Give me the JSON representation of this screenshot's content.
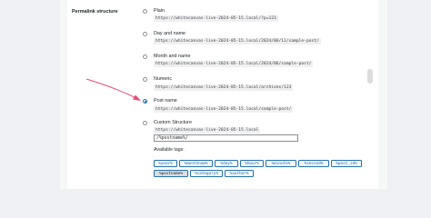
{
  "section": {
    "label": "Permalink structure"
  },
  "options": [
    {
      "label": "Plain",
      "example": "https://whitecanvas-live-2024-05-15.local/?p=123",
      "checked": false
    },
    {
      "label": "Day and name",
      "example": "https://whitecanvas-live-2024-05-15.local/2024/06/11/sample-post/",
      "checked": false
    },
    {
      "label": "Month and name",
      "example": "https://whitecanvas-live-2024-05-15.local/2024/06/sample-post/",
      "checked": false
    },
    {
      "label": "Numeric",
      "example": "https://whitecanvas-live-2024-05-15.local/archives/123",
      "checked": false
    },
    {
      "label": "Post name",
      "example": "https://whitecanvas-live-2024-05-15.local/sample-post/",
      "checked": true
    },
    {
      "label": "Custom Structure",
      "checked": false
    }
  ],
  "custom": {
    "prefix": "https://whitecanvas-live-2024-05-15.local",
    "value": "/%postname%/"
  },
  "available_tags": {
    "label": "Available tags:",
    "tags": [
      "%year%",
      "%monthnum%",
      "%day%",
      "%hour%",
      "%minute%",
      "%second%",
      "%post_id%",
      "%postname%",
      "%category%",
      "%author%"
    ],
    "active": "%postname%"
  },
  "colors": {
    "accent": "#2271b1",
    "arrow": "#e84a78"
  }
}
